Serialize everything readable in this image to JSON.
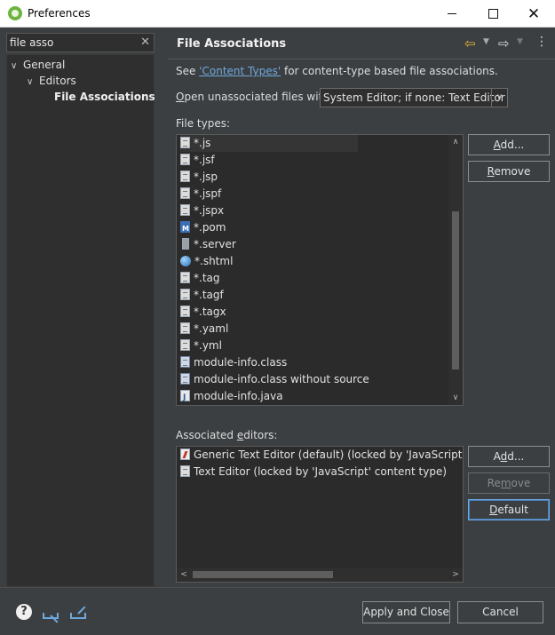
{
  "window": {
    "title": "Preferences",
    "minimize_glyph": "—",
    "maximize_glyph": "□",
    "close_glyph": "✕"
  },
  "filter": {
    "value": "file asso",
    "clear_glyph": "✕"
  },
  "tree": {
    "items": [
      {
        "label": "General"
      },
      {
        "label": "Editors"
      },
      {
        "label": "File Associations"
      }
    ]
  },
  "page": {
    "title": "File Associations",
    "see_prefix": "See ",
    "see_link": "'Content Types'",
    "see_suffix": " for content-type based file associations.",
    "open_label_u": "O",
    "open_label_rest": "pen unassociated files with:",
    "open_value": "System Editor; if none: Text Editor"
  },
  "file_types": {
    "label": "File types:",
    "items": [
      {
        "label": "*.js",
        "icon": "text-file-icon"
      },
      {
        "label": "*.jsf",
        "icon": "text-file-icon"
      },
      {
        "label": "*.jsp",
        "icon": "text-file-icon"
      },
      {
        "label": "*.jspf",
        "icon": "text-file-icon"
      },
      {
        "label": "*.jspx",
        "icon": "text-file-icon"
      },
      {
        "label": "*.pom",
        "icon": "maven-icon"
      },
      {
        "label": "*.server",
        "icon": "server-icon"
      },
      {
        "label": "*.shtml",
        "icon": "globe-icon"
      },
      {
        "label": "*.tag",
        "icon": "text-file-icon"
      },
      {
        "label": "*.tagf",
        "icon": "text-file-icon"
      },
      {
        "label": "*.tagx",
        "icon": "text-file-icon"
      },
      {
        "label": "*.yaml",
        "icon": "text-file-icon"
      },
      {
        "label": "*.yml",
        "icon": "text-file-icon"
      },
      {
        "label": "module-info.class",
        "icon": "class-file-icon"
      },
      {
        "label": "module-info.class without source",
        "icon": "class-file-icon"
      },
      {
        "label": "module-info.java",
        "icon": "java-file-icon"
      }
    ],
    "add_u": "A",
    "add_rest": "dd...",
    "remove_u": "R",
    "remove_rest": "emove"
  },
  "associated_editors": {
    "label_prefix": "Associated ",
    "label_u": "e",
    "label_rest": "ditors:",
    "items": [
      {
        "label": "Generic Text Editor (default) (locked by 'JavaScript' content type)",
        "icon": "generic-editor-icon"
      },
      {
        "label": "Text Editor (locked by 'JavaScript' content type)",
        "icon": "text-editor-icon"
      }
    ],
    "add_u": "d",
    "add_prefix": "A",
    "add_rest": "d...",
    "remove_prefix": "Re",
    "remove_u": "m",
    "remove_rest": "ove",
    "default_prefix": "",
    "default_u": "D",
    "default_rest": "efault"
  },
  "footer": {
    "apply_close": "Apply and Close",
    "cancel": "Cancel",
    "help_glyph": "?"
  },
  "colors": {
    "link": "#6fa8dc",
    "accent": "#e8b43a"
  }
}
